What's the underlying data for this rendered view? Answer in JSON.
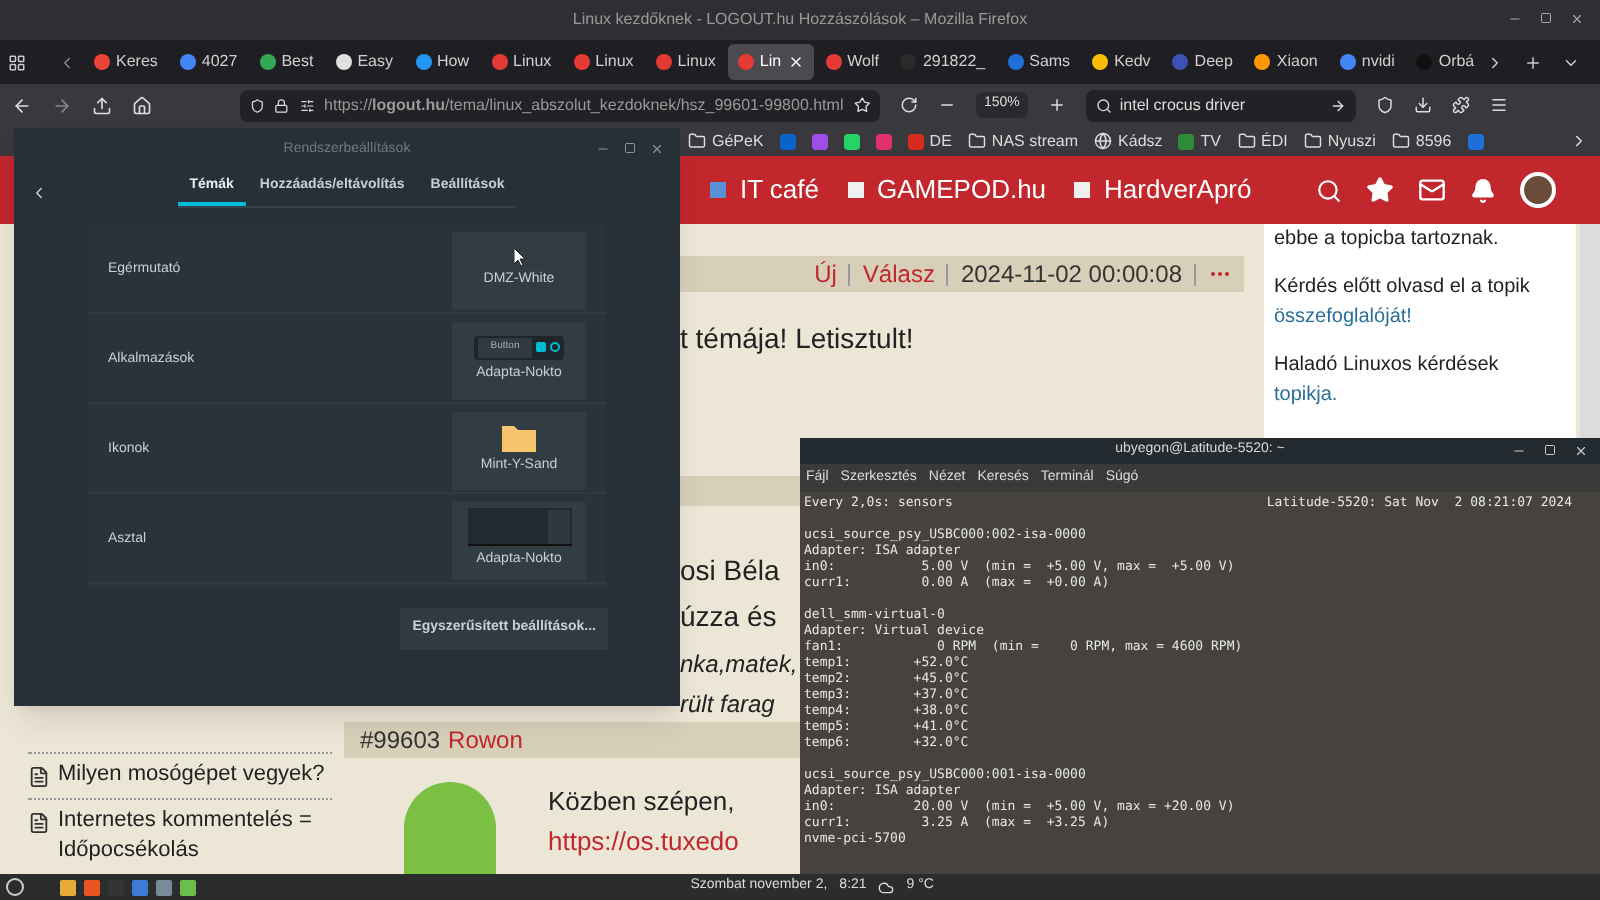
{
  "window": {
    "title": "Linux kezdőknek - LOGOUT.hu Hozzászólások – Mozilla Firefox"
  },
  "tabs": [
    {
      "label": "Keres",
      "color": "#ea4335",
      "selected": false
    },
    {
      "label": "4027",
      "color": "#4285f4",
      "selected": false
    },
    {
      "label": "Best",
      "color": "#34a853",
      "selected": false
    },
    {
      "label": "Easy",
      "color": "#e0e0e0",
      "selected": false
    },
    {
      "label": "How",
      "color": "#2196f3",
      "selected": false
    },
    {
      "label": "Linux",
      "color": "#e53935",
      "selected": false
    },
    {
      "label": "Linux",
      "color": "#e53935",
      "selected": false
    },
    {
      "label": "Linux",
      "color": "#e53935",
      "selected": false
    },
    {
      "label": "Lin",
      "color": "#e53935",
      "selected": true
    },
    {
      "label": "Wolf",
      "color": "#e53935",
      "selected": false
    },
    {
      "label": "291822_",
      "color": "#2b2b2b",
      "selected": false
    },
    {
      "label": "Sams",
      "color": "#1e6fd9",
      "selected": false
    },
    {
      "label": "Kedv",
      "color": "#fbbc05",
      "selected": false
    },
    {
      "label": "Deep",
      "color": "#3f51b5",
      "selected": false
    },
    {
      "label": "Xiaon",
      "color": "#ff9800",
      "selected": false
    },
    {
      "label": "nvidi",
      "color": "#4285f4",
      "selected": false
    },
    {
      "label": "Orbá",
      "color": "#111111",
      "selected": false
    }
  ],
  "navigation": {
    "url": "https://**logout.hu**/tema/linux_abszolut_kezdoknek/hsz_99601-99800.html",
    "zoom": "150%",
    "search_value": "intel crocus driver"
  },
  "bookmarks": [
    {
      "kind": "folder",
      "label": "GéPeK"
    },
    {
      "kind": "site",
      "color": "#0a64c8"
    },
    {
      "kind": "site",
      "color": "#a04ee8"
    },
    {
      "kind": "site",
      "color": "#25d366"
    },
    {
      "kind": "site",
      "color": "#e1306c"
    },
    {
      "kind": "site",
      "color": "#d62b1f",
      "label": "DE"
    },
    {
      "kind": "folder",
      "label": "NAS stream"
    },
    {
      "kind": "globe",
      "label": "Kádsz"
    },
    {
      "kind": "site",
      "color": "#2e8b3a",
      "label": "TV"
    },
    {
      "kind": "folder",
      "label": "ÉDI"
    },
    {
      "kind": "folder",
      "label": "Nyuszi"
    },
    {
      "kind": "folder",
      "label": "8596"
    },
    {
      "kind": "site",
      "color": "#1e6fd9"
    }
  ],
  "site_header": {
    "links": [
      {
        "label": "IT café",
        "color": "#5b8fd6"
      },
      {
        "label": "GAMEPOD.hu",
        "color": "#f0f0f0"
      },
      {
        "label": "HardverApró",
        "color": "#f0f0f0"
      }
    ]
  },
  "forum": {
    "sidebar_items": [
      {
        "label": "Milyen mosógépet vegyek?"
      },
      {
        "label": "Internetes kommentelés = Időpocsékolás"
      }
    ],
    "posts": [
      {
        "header": {
          "new": "Új",
          "reply": "Válasz",
          "date": "2024-11-02 00:00:08"
        },
        "lines": [
          "t témája! Letisztult!"
        ]
      },
      {
        "lines": [
          "osi Béla",
          "úzza és"
        ],
        "italic_lines": [
          "nka,matek,",
          "rült farag"
        ]
      },
      {
        "number": "#99603",
        "author": "Rowon",
        "lines": [
          "Közben szépen,"
        ],
        "link": "https://os.tuxedo"
      }
    ],
    "side_box": [
      {
        "text": "ebbe a topicba tartoznak."
      },
      {
        "text": "Kérdés előtt olvasd el a topik",
        "link": "összefoglalóját!"
      },
      {
        "text": "Haladó Linuxos kérdések",
        "link": "topikja."
      }
    ]
  },
  "settings_dialog": {
    "title": "Rendszerbeállítások",
    "tabs": [
      {
        "label": "Témák",
        "selected": true
      },
      {
        "label": "Hozzáadás/eltávolítás",
        "selected": false
      },
      {
        "label": "Beállítások",
        "selected": false
      }
    ],
    "rows": [
      {
        "label": "Egérmutató",
        "kind": "cursor",
        "theme": "DMZ-White"
      },
      {
        "label": "Alkalmazások",
        "kind": "widgets",
        "theme": "Adapta-Nokto",
        "preview_label": "Button"
      },
      {
        "label": "Ikonok",
        "kind": "icons",
        "theme": "Mint-Y-Sand"
      },
      {
        "label": "Asztal",
        "kind": "desktop",
        "theme": "Adapta-Nokto"
      }
    ],
    "button": "Egyszerűsített beállítások..."
  },
  "terminal": {
    "title": "ubyegon@Latitude-5520: ~",
    "menu": [
      "Fájl",
      "Szerkesztés",
      "Nézet",
      "Keresés",
      "Terminál",
      "Súgó"
    ],
    "header_left": "Every 2,0s: sensors",
    "header_right": "Latitude-5520: Sat Nov  2 08:21:07 2024",
    "blocks": [
      [
        "ucsi_source_psy_USBC000:002-isa-0000",
        "Adapter: ISA adapter",
        "in0:           5.00 V  (min =  +5.00 V, max =  +5.00 V)",
        "curr1:         0.00 A  (max =  +0.00 A)"
      ],
      [
        "dell_smm-virtual-0",
        "Adapter: Virtual device",
        "fan1:            0 RPM  (min =    0 RPM, max = 4600 RPM)",
        "temp1:        +52.0°C",
        "temp2:        +45.0°C",
        "temp3:        +37.0°C",
        "temp4:        +38.0°C",
        "temp5:        +41.0°C",
        "temp6:        +32.0°C"
      ],
      [
        "ucsi_source_psy_USBC000:001-isa-0000",
        "Adapter: ISA adapter",
        "in0:          20.00 V  (min =  +5.00 V, max = +20.00 V)",
        "curr1:         3.25 A  (max =  +3.25 A)",
        "nvme-pci-5700"
      ]
    ]
  },
  "taskbar": {
    "apps": [
      {
        "color": "#e8a93b"
      },
      {
        "color": "#e95420"
      },
      {
        "color": "#333333"
      },
      {
        "color": "#3b7dd8"
      },
      {
        "color": "#7a8a99"
      },
      {
        "color": "#6abf4b"
      }
    ],
    "date": "Szombat november 2,",
    "time": "8:21",
    "temperature": "9 °C"
  }
}
